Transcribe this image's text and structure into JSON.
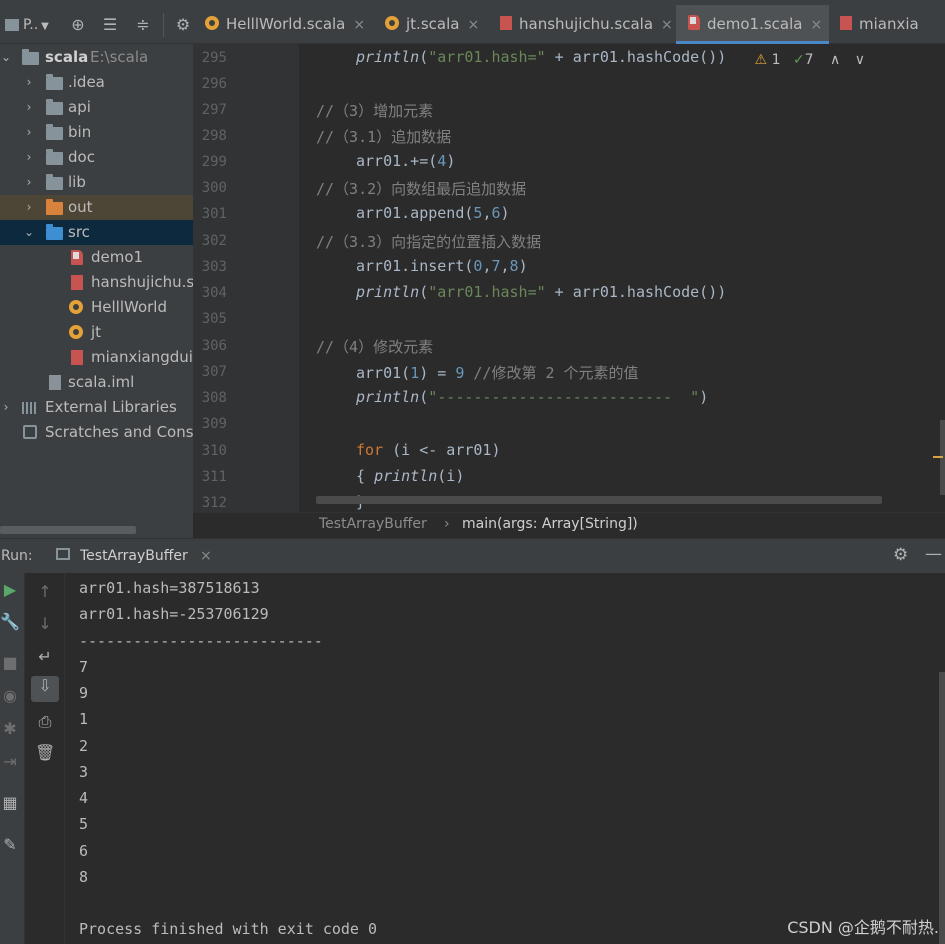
{
  "toolbar": {
    "project_label": "P..",
    "tabs": [
      {
        "label": "HelllWorld.scala",
        "icon": "scala-object-icon"
      },
      {
        "label": "jt.scala",
        "icon": "scala-object-icon"
      },
      {
        "label": "hanshujichu.scala",
        "icon": "scala-file-icon"
      },
      {
        "label": "demo1.scala",
        "icon": "scala-class-icon",
        "active": true
      },
      {
        "label": "mianxia",
        "icon": "scala-file-icon"
      }
    ],
    "close_glyph": "×"
  },
  "sidebar": {
    "items": [
      {
        "label": "scala",
        "path": "E:\\scala",
        "type": "root"
      },
      {
        "label": ".idea",
        "type": "folder"
      },
      {
        "label": "api",
        "type": "folder"
      },
      {
        "label": "bin",
        "type": "folder"
      },
      {
        "label": "doc",
        "type": "folder"
      },
      {
        "label": "lib",
        "type": "folder"
      },
      {
        "label": "out",
        "type": "folder-excluded"
      },
      {
        "label": "src",
        "type": "folder-source"
      },
      {
        "label": "demo1",
        "type": "scala-class"
      },
      {
        "label": "hanshujichu.sc",
        "type": "scala-file"
      },
      {
        "label": "HelllWorld",
        "type": "scala-object"
      },
      {
        "label": "jt",
        "type": "scala-object"
      },
      {
        "label": "mianxiangduix",
        "type": "scala-file"
      },
      {
        "label": "scala.iml",
        "type": "iml"
      },
      {
        "label": "External Libraries",
        "type": "libraries"
      },
      {
        "label": "Scratches and Conso",
        "type": "scratches"
      }
    ]
  },
  "editor": {
    "warnings": "1",
    "checks": "7",
    "line_numbers": [
      "295",
      "296",
      "297",
      "298",
      "299",
      "300",
      "301",
      "302",
      "303",
      "304",
      "305",
      "306",
      "307",
      "308",
      "309",
      "310",
      "311",
      "312"
    ],
    "lines": {
      "l295_fn": "println",
      "l295_str": "\"arr01.hash=\"",
      "l295_rest": " + arr01.hashCode())",
      "l297": "//（3）增加元素",
      "l298": "//（3.1）追加数据",
      "l299_a": "arr01.+=(",
      "l299_n": "4",
      "l299_b": ")",
      "l300": "//（3.2）向数组最后追加数据",
      "l301_a": "arr01.append(",
      "l301_n1": "5",
      "l301_c": ",",
      "l301_n2": "6",
      "l301_b": ")",
      "l302": "//（3.3）向指定的位置插入数据",
      "l303_a": "arr01.insert(",
      "l303_n1": "0",
      "l303_c1": ",",
      "l303_n2": "7",
      "l303_c2": ",",
      "l303_n3": "8",
      "l303_b": ")",
      "l304_fn": "println",
      "l304_str": "\"arr01.hash=\"",
      "l304_rest": " + arr01.hashCode())",
      "l306": "//（4）修改元素",
      "l307_a": "arr01(",
      "l307_n1": "1",
      "l307_b": ") = ",
      "l307_n2": "9",
      "l307_cm": " //修改第 2 个元素的值",
      "l308_fn": "println",
      "l308_str": "\"--------------------------  \"",
      "l308_b": ")",
      "l310_kw": "for",
      "l310_rest": " (i <- arr01)",
      "l311_a": "{ ",
      "l311_fn": "println",
      "l311_b": "(i)",
      "l312": "}"
    }
  },
  "breadcrumb": {
    "class_name": "TestArrayBuffer",
    "separator": "›",
    "method": "main(args: Array[String])"
  },
  "run": {
    "label": "Run:",
    "tab_label": "TestArrayBuffer",
    "console_lines": [
      "arr01.hash=387518613",
      "arr01.hash=-253706129",
      "---------------------------",
      "7",
      "9",
      "1",
      "2",
      "3",
      "4",
      "5",
      "6",
      "8",
      "",
      "Process finished with exit code 0"
    ]
  },
  "watermark": "CSDN @企鹅不耐热."
}
